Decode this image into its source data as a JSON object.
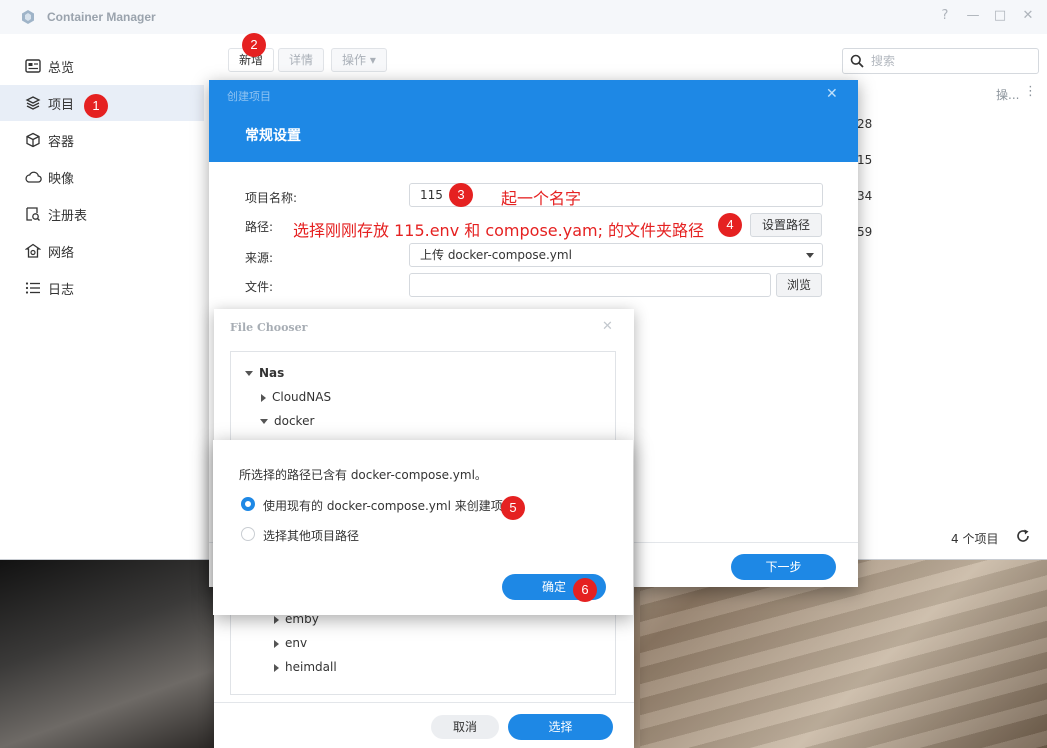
{
  "window": {
    "title": "Container Manager",
    "controls": [
      "?",
      "—",
      "□",
      "✕"
    ]
  },
  "sidebar": {
    "items": [
      {
        "label": "总览",
        "icon": "overview-icon"
      },
      {
        "label": "项目",
        "icon": "project-icon",
        "active": true
      },
      {
        "label": "容器",
        "icon": "container-icon"
      },
      {
        "label": "映像",
        "icon": "image-cloud-icon"
      },
      {
        "label": "注册表",
        "icon": "registry-icon"
      },
      {
        "label": "网络",
        "icon": "network-icon"
      },
      {
        "label": "日志",
        "icon": "log-icon"
      }
    ]
  },
  "toolbar": {
    "new_label": "新增",
    "details_label": "详情",
    "action_label": "操作 ▾",
    "search_placeholder": "搜索"
  },
  "list": {
    "op_header": "操...",
    "more": "⋮",
    "row_values": [
      "28",
      "15",
      "34",
      "59"
    ],
    "item_count": "4 个项目"
  },
  "create_dialog": {
    "title": "创建项目",
    "section": "常规设置",
    "name_label": "项目名称:",
    "name_value": "115",
    "path_label": "路径:",
    "set_path_button": "设置路径",
    "source_label": "来源:",
    "source_value": "上传 docker-compose.yml",
    "file_label": "文件:",
    "browse_button": "浏览",
    "next_button": "下一步"
  },
  "annotations": {
    "name_hint": "起一个名字",
    "path_hint": "选择刚刚存放 115.env 和 compose.yam; 的文件夹路径",
    "steps": [
      "1",
      "2",
      "3",
      "4",
      "5",
      "6"
    ]
  },
  "file_chooser": {
    "title": "File Chooser",
    "tree": [
      {
        "label": "Nas",
        "expanded": true,
        "level": 0
      },
      {
        "label": "CloudNAS",
        "expanded": false,
        "level": 1
      },
      {
        "label": "docker",
        "expanded": true,
        "level": 1
      },
      {
        "label": "emby",
        "expanded": false,
        "level": 2
      },
      {
        "label": "env",
        "expanded": false,
        "level": 2
      },
      {
        "label": "heimdall",
        "expanded": false,
        "level": 2
      }
    ],
    "cancel_button": "取消",
    "select_button": "选择"
  },
  "confirm_dialog": {
    "message": "所选择的路径已含有 docker-compose.yml。",
    "option_use_existing": "使用现有的 docker-compose.yml 来创建项目",
    "option_choose_other": "选择其他项目路径",
    "ok_button": "确定"
  },
  "colors": {
    "accent": "#1e88e5",
    "annotation": "#e52121",
    "sidebar_active": "#e8eef7"
  }
}
